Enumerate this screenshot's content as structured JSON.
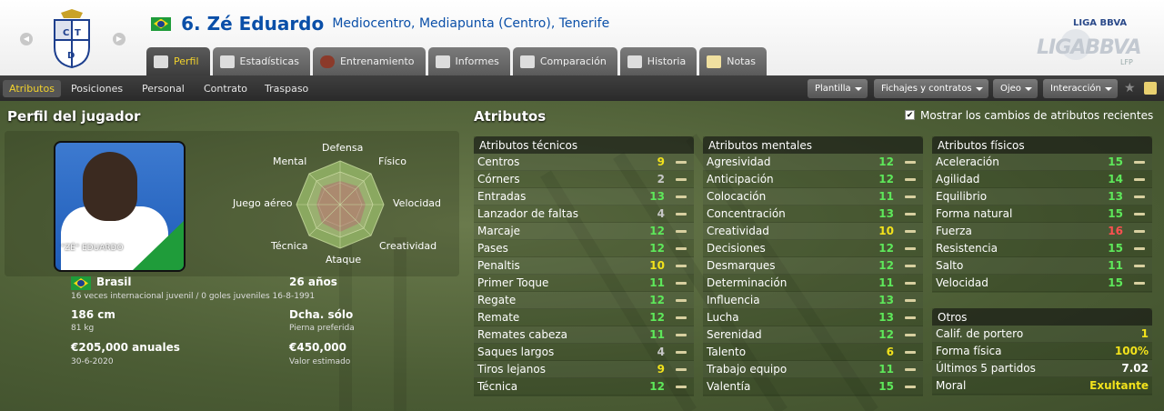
{
  "header": {
    "number_name": "6. Zé Eduardo",
    "positions": "Mediocentro, Mediapunta (Centro), Tenerife",
    "club_crest_text": "CDT",
    "league_logo_small": "LIGA BBVA",
    "league_logo_big": "LIGABBVA",
    "league_logo_lfp": "LFP"
  },
  "tabs": [
    {
      "label": "Perfil"
    },
    {
      "label": "Estadísticas"
    },
    {
      "label": "Entrenamiento"
    },
    {
      "label": "Informes"
    },
    {
      "label": "Comparación"
    },
    {
      "label": "Historia"
    },
    {
      "label": "Notas"
    }
  ],
  "subtabs": [
    "Atributos",
    "Posiciones",
    "Personal",
    "Contrato",
    "Traspaso"
  ],
  "dropdowns": [
    "Plantilla",
    "Fichajes y contratos",
    "Ojeo",
    "Interacción"
  ],
  "profile": {
    "title": "Perfil del jugador",
    "photo_caption": "\"ZÉ\" EDUARDO",
    "nationality": "Brasil",
    "intl": "16 veces internacional juvenil / 0 goles juveniles 16-8-1991",
    "age": "26 años",
    "height": "186 cm",
    "weight": "81 kg",
    "foot": "Dcha. sólo",
    "foot_label": "Pierna preferida",
    "wage": "€205,000 anuales",
    "contract_end": "30-6-2020",
    "value": "€450,000",
    "value_label": "Valor estimado"
  },
  "radar": {
    "labels": [
      "Defensa",
      "Físico",
      "Velocidad",
      "Creatividad",
      "Ataque",
      "Técnica",
      "Juego aéreo",
      "Mental"
    ]
  },
  "attributes": {
    "title": "Atributos",
    "show_changes": "Mostrar los cambios de atributos recientes",
    "technical": {
      "title": "Atributos técnicos",
      "rows": [
        {
          "name": "Centros",
          "value": "9"
        },
        {
          "name": "Córners",
          "value": "2"
        },
        {
          "name": "Entradas",
          "value": "13"
        },
        {
          "name": "Lanzador de faltas",
          "value": "4"
        },
        {
          "name": "Marcaje",
          "value": "12"
        },
        {
          "name": "Pases",
          "value": "12"
        },
        {
          "name": "Penaltis",
          "value": "10"
        },
        {
          "name": "Primer Toque",
          "value": "11"
        },
        {
          "name": "Regate",
          "value": "12"
        },
        {
          "name": "Remate",
          "value": "12"
        },
        {
          "name": "Remates cabeza",
          "value": "11"
        },
        {
          "name": "Saques largos",
          "value": "4"
        },
        {
          "name": "Tiros lejanos",
          "value": "9"
        },
        {
          "name": "Técnica",
          "value": "12"
        }
      ]
    },
    "mental": {
      "title": "Atributos mentales",
      "rows": [
        {
          "name": "Agresividad",
          "value": "12"
        },
        {
          "name": "Anticipación",
          "value": "12"
        },
        {
          "name": "Colocación",
          "value": "11"
        },
        {
          "name": "Concentración",
          "value": "13"
        },
        {
          "name": "Creatividad",
          "value": "10"
        },
        {
          "name": "Decisiones",
          "value": "12"
        },
        {
          "name": "Desmarques",
          "value": "12"
        },
        {
          "name": "Determinación",
          "value": "11"
        },
        {
          "name": "Influencia",
          "value": "13"
        },
        {
          "name": "Lucha",
          "value": "13"
        },
        {
          "name": "Serenidad",
          "value": "12"
        },
        {
          "name": "Talento",
          "value": "6"
        },
        {
          "name": "Trabajo equipo",
          "value": "11"
        },
        {
          "name": "Valentía",
          "value": "15"
        }
      ]
    },
    "physical": {
      "title": "Atributos físicos",
      "rows": [
        {
          "name": "Aceleración",
          "value": "15"
        },
        {
          "name": "Agilidad",
          "value": "14"
        },
        {
          "name": "Equilibrio",
          "value": "13"
        },
        {
          "name": "Forma natural",
          "value": "15"
        },
        {
          "name": "Fuerza",
          "value": "16"
        },
        {
          "name": "Resistencia",
          "value": "15"
        },
        {
          "name": "Salto",
          "value": "11"
        },
        {
          "name": "Velocidad",
          "value": "15"
        }
      ]
    },
    "other": {
      "title": "Otros",
      "rows": [
        {
          "name": "Calif. de portero",
          "value": "1"
        },
        {
          "name": "Forma física",
          "value": "100%"
        },
        {
          "name": "Últimos 5 partidos",
          "value": "7.02"
        },
        {
          "name": "Moral",
          "value": "Exultante"
        }
      ]
    }
  },
  "colors": {
    "accent_tab": "#f2d22c",
    "value_green": "#5ee85a",
    "value_yellow": "#f2e21c",
    "value_red": "#ff5050",
    "value_grey": "#c8c8c8"
  }
}
